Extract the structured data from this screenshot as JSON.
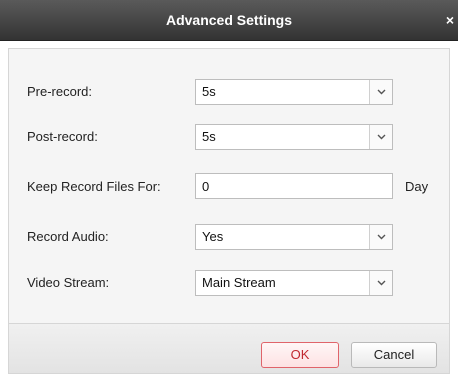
{
  "dialog": {
    "title": "Advanced Settings",
    "close_glyph": "×"
  },
  "fields": {
    "pre_record": {
      "label": "Pre-record:",
      "value": "5s"
    },
    "post_record": {
      "label": "Post-record:",
      "value": "5s"
    },
    "keep_files": {
      "label": "Keep Record Files For:",
      "value": "0",
      "unit": "Day"
    },
    "record_audio": {
      "label": "Record Audio:",
      "value": "Yes"
    },
    "video_stream": {
      "label": "Video Stream:",
      "value": "Main Stream"
    }
  },
  "buttons": {
    "ok_label": "OK",
    "cancel_label": "Cancel"
  },
  "icons": {
    "dropdown": "chevron-down-icon",
    "close": "close-icon"
  },
  "colors": {
    "titlebar": "#444444",
    "ok_border": "#e0646a",
    "ok_text": "#c0282f"
  }
}
